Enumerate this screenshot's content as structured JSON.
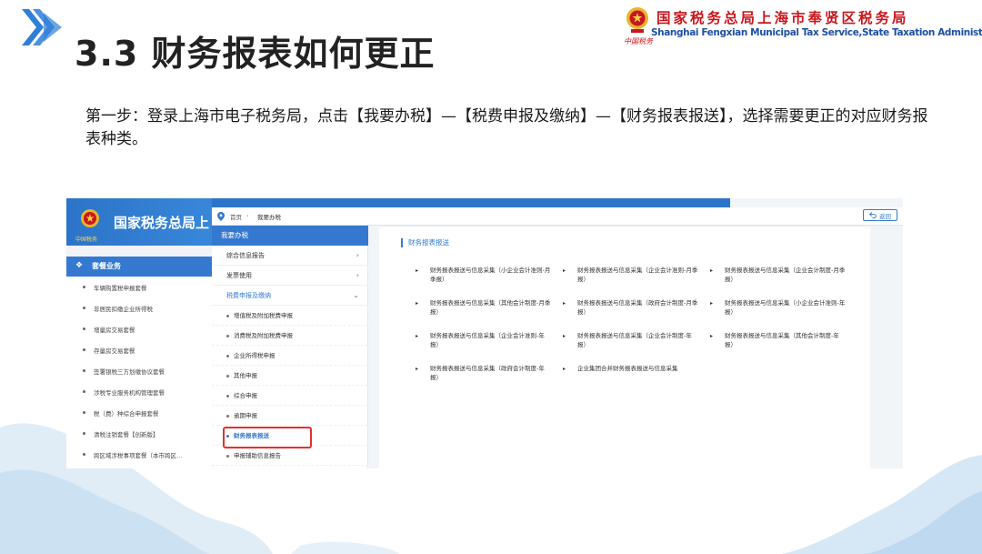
{
  "slide": {
    "title": "3.3 财务报表如何更正",
    "instruction": "第一步：登录上海市电子税务局，点击【我要办税】—【税费申报及缴纳】—【财务报表报送】，选择需要更正的对应财务报表种类。"
  },
  "brand": {
    "name_cn": "国家税务总局上海市奉贤区税务局",
    "name_en": "Shanghai Fengxian Municipal Tax Service,State Taxation Administration",
    "seal_text": "中国税务"
  },
  "screenshot": {
    "left_panel": {
      "banner_title": "国家税务总局上",
      "seal_text": "中国税务",
      "section_label": "套餐业务",
      "items": [
        "车辆购置税申报套餐",
        "非居民扣缴企业所得税",
        "增量房交易套餐",
        "存量房交易套餐",
        "签署银税三方划缴协议套餐",
        "涉税专业服务机构管理套餐",
        "税（费）种综合申报套餐",
        "清税注销套餐【创新版】",
        "跨区域涉税事项套餐（本市跨区…"
      ]
    },
    "breadcrumb": {
      "home": "首页",
      "separator": "›",
      "current": "我要办税"
    },
    "back_button": {
      "label": "返回"
    },
    "side_menu": {
      "header": "我要办税",
      "rows": [
        {
          "label": "综合信息报告",
          "chevron": "›"
        },
        {
          "label": "发票使用",
          "chevron": "›"
        },
        {
          "label": "税费申报及缴纳",
          "chevron": "⌄"
        }
      ],
      "sub_items": [
        "增值税及附加税费申报",
        "消费税及附加税费申报",
        "企业所得税申报",
        "其他申报",
        "综合申报",
        "逾期申报",
        "财务报表报送",
        "申报辅助信息报告"
      ],
      "active_sub_index": 6
    },
    "content": {
      "title": "财务报表报送",
      "reports": [
        "财务报表报送与信息采集（小企业会计准则-月季报）",
        "财务报表报送与信息采集（企业会计准则-月季报）",
        "财务报表报送与信息采集（企业会计制度-月季报）",
        "财务报表报送与信息采集（其他会计制度-月季报）",
        "财务报表报送与信息采集（政府会计制度-月季报）",
        "财务报表报送与信息采集（小企业会计准则-年报）",
        "财务报表报送与信息采集（企业会计准则-年报）",
        "财务报表报送与信息采集（企业会计制度-年报）",
        "财务报表报送与信息采集（其他会计制度-年报）",
        "财务报表报送与信息采集（政府会计制度-年报）",
        "企业集团合并财务报表报送与信息采集"
      ]
    }
  },
  "colors": {
    "accent_blue": "#3479cf",
    "brand_red": "#c8161d",
    "highlight_red": "#e53030",
    "chevron_blue": "#2f7fd9"
  },
  "icons": {
    "slide_marker": "chevron-arrows-icon",
    "emblem": "national-emblem-icon",
    "home": "location-pin-icon",
    "back": "return-arrow-icon",
    "report_bullet": "triangle-bullet-icon"
  }
}
